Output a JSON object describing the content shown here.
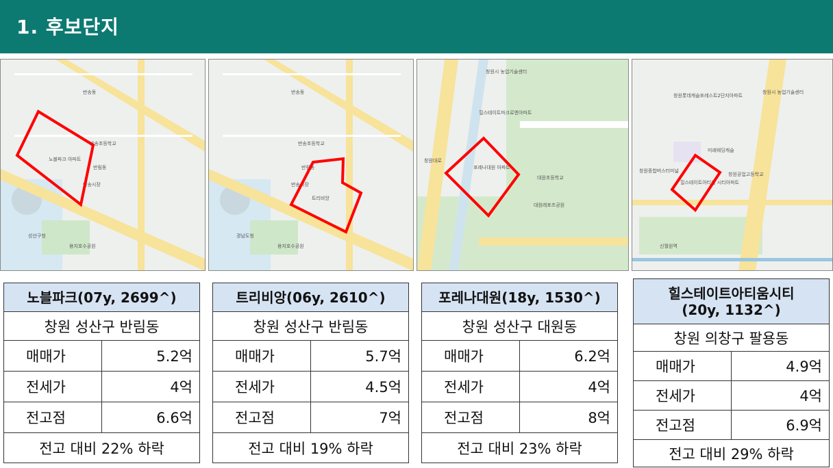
{
  "header": {
    "title": "1. 후보단지"
  },
  "maps": [
    {
      "labels": [
        "반송동",
        "노블파크 아파트",
        "반림동",
        "반송초등학교",
        "성산구청",
        "반송시장",
        "용지호수공원"
      ]
    },
    {
      "labels": [
        "반송동",
        "트리비앙",
        "반림동",
        "반송초등학교",
        "경남도청",
        "반송시장",
        "용지호수공원"
      ]
    },
    {
      "labels": [
        "창원시 농업기술센터",
        "힐스테이트마크로엔아파트",
        "포레나대원 아파트",
        "대원초등학교",
        "대원레포츠공원",
        "창원대로"
      ]
    },
    {
      "labels": [
        "창원롯데캐슬포레스트2단지아파트",
        "힐스테이트아티움 시티아파트",
        "창원공업고등학교",
        "미래웨딩캐슬",
        "창원종합버스터미널",
        "신월원역",
        "창원시 농업기술센터"
      ]
    }
  ],
  "tables": [
    {
      "title": "노블파크(07y, 2699^)",
      "location": "창원 성산구 반림동",
      "rows": [
        {
          "label": "매매가",
          "value": "5.2억"
        },
        {
          "label": "전세가",
          "value": "4억"
        },
        {
          "label": "전고점",
          "value": "6.6억"
        }
      ],
      "footer": "전고 대비 22% 하락"
    },
    {
      "title": "트리비앙(06y, 2610^)",
      "location": "창원 성산구 반림동",
      "rows": [
        {
          "label": "매매가",
          "value": "5.7억"
        },
        {
          "label": "전세가",
          "value": "4.5억"
        },
        {
          "label": "전고점",
          "value": "7억"
        }
      ],
      "footer": "전고 대비 19% 하락"
    },
    {
      "title": "포레나대원(18y, 1530^)",
      "location": "창원 성산구 대원동",
      "rows": [
        {
          "label": "매매가",
          "value": "6.2억"
        },
        {
          "label": "전세가",
          "value": "4억"
        },
        {
          "label": "전고점",
          "value": "8억"
        }
      ],
      "footer": "전고 대비 23% 하락"
    },
    {
      "title_line1": "힐스테이트아티움시티",
      "title_line2": "(20y, 1132^)",
      "location": "창원 의창구 팔용동",
      "rows": [
        {
          "label": "매매가",
          "value": "4.9억"
        },
        {
          "label": "전세가",
          "value": "4억"
        },
        {
          "label": "전고점",
          "value": "6.9억"
        }
      ],
      "footer": "전고 대비 29% 하락"
    }
  ],
  "colors": {
    "header_bg": "#0d7a72",
    "title_cell_bg": "#d6e3f3",
    "highlight": "#ff0000",
    "road_yellow": "#f7e39a",
    "park_green": "#cfe7c9"
  }
}
